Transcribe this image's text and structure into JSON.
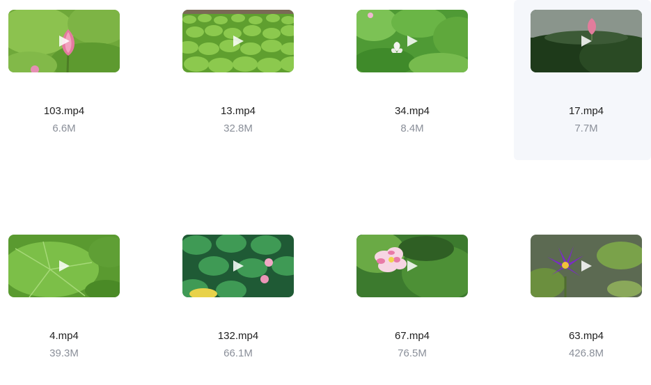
{
  "files": [
    {
      "name": "103.mp4",
      "size": "6.6M"
    },
    {
      "name": "13.mp4",
      "size": "32.8M"
    },
    {
      "name": "34.mp4",
      "size": "8.4M"
    },
    {
      "name": "17.mp4",
      "size": "7.7M"
    },
    {
      "name": "4.mp4",
      "size": "39.3M"
    },
    {
      "name": "132.mp4",
      "size": "66.1M"
    },
    {
      "name": "67.mp4",
      "size": "76.5M"
    },
    {
      "name": "63.mp4",
      "size": "426.8M"
    }
  ],
  "icons": {
    "play": "play-icon"
  },
  "colors": {
    "hover_bg": "#f5f7fb",
    "size_text": "#8a8f99",
    "name_text": "#1f1f1f"
  }
}
